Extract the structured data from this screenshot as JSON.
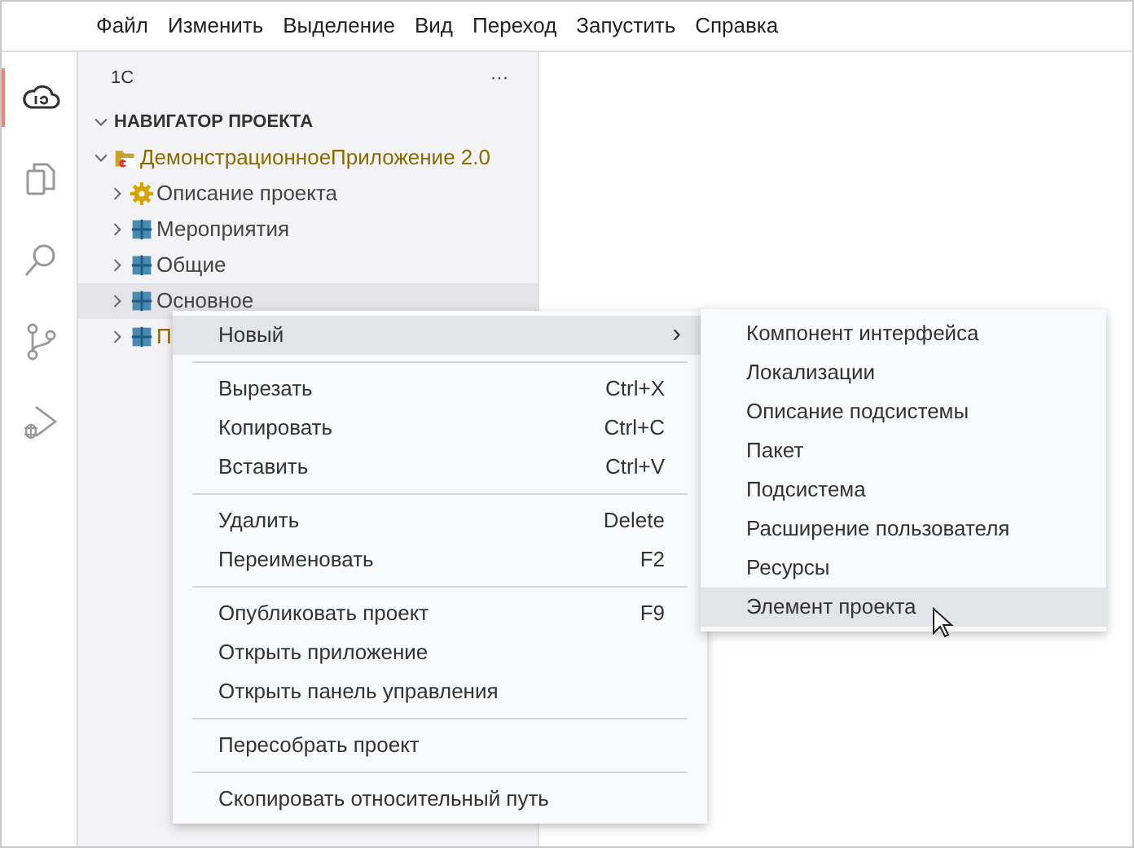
{
  "menubar": [
    "Файл",
    "Изменить",
    "Выделение",
    "Вид",
    "Переход",
    "Запустить",
    "Справка"
  ],
  "activity_bar": [
    {
      "kind": "cloud",
      "selected": true
    },
    {
      "kind": "files",
      "selected": false
    },
    {
      "kind": "search",
      "selected": false
    },
    {
      "kind": "branch",
      "selected": false
    },
    {
      "kind": "debug",
      "selected": false
    }
  ],
  "sidebar": {
    "title": "1С",
    "more": "···",
    "section": {
      "label": "НАВИГАТОР ПРОЕКТА",
      "expanded": true,
      "tree": [
        {
          "label": "ДемонстрационноеПриложение 2.0",
          "kind": "folder",
          "color": "#8a6a00",
          "expanded": true,
          "selected": false,
          "children": [
            {
              "label": "Описание проекта",
              "kind": "gear",
              "color": "#444444",
              "expanded": false,
              "selected": false
            },
            {
              "label": "Мероприятия",
              "kind": "grid",
              "color": "#444444",
              "expanded": false,
              "selected": false
            },
            {
              "label": "Общие",
              "kind": "grid",
              "color": "#444444",
              "expanded": false,
              "selected": false
            },
            {
              "label": "Основное",
              "kind": "grid",
              "color": "#444444",
              "expanded": false,
              "selected": true
            },
            {
              "label": "П",
              "kind": "grid",
              "color": "#8a6a00",
              "expanded": false,
              "selected": false
            }
          ]
        }
      ]
    }
  },
  "context_menu": {
    "groups": [
      [
        {
          "label": "Новый",
          "submenu": true,
          "selected": true
        }
      ],
      [
        {
          "label": "Вырезать",
          "shortcut": "Ctrl+X",
          "selected": false
        },
        {
          "label": "Копировать",
          "shortcut": "Ctrl+C",
          "selected": false
        },
        {
          "label": "Вставить",
          "shortcut": "Ctrl+V",
          "selected": false
        }
      ],
      [
        {
          "label": "Удалить",
          "shortcut": "Delete",
          "selected": false
        },
        {
          "label": "Переименовать",
          "shortcut": "F2",
          "selected": false
        }
      ],
      [
        {
          "label": "Опубликовать проект",
          "shortcut": "F9",
          "selected": false
        },
        {
          "label": "Открыть приложение",
          "selected": false
        },
        {
          "label": "Открыть панель управления",
          "selected": false
        }
      ],
      [
        {
          "label": "Пересобрать проект",
          "selected": false
        }
      ],
      [
        {
          "label": "Скопировать относительный путь",
          "selected": false
        }
      ]
    ],
    "submenu_arrow": "›"
  },
  "submenu": [
    {
      "label": "Компонент интерфейса",
      "selected": false
    },
    {
      "label": "Локализации",
      "selected": false
    },
    {
      "label": "Описание подсистемы",
      "selected": false
    },
    {
      "label": "Пакет",
      "selected": false
    },
    {
      "label": "Подсистема",
      "selected": false
    },
    {
      "label": "Расширение пользователя",
      "selected": false
    },
    {
      "label": "Ресурсы",
      "selected": false
    },
    {
      "label": "Элемент проекта",
      "selected": true
    }
  ]
}
